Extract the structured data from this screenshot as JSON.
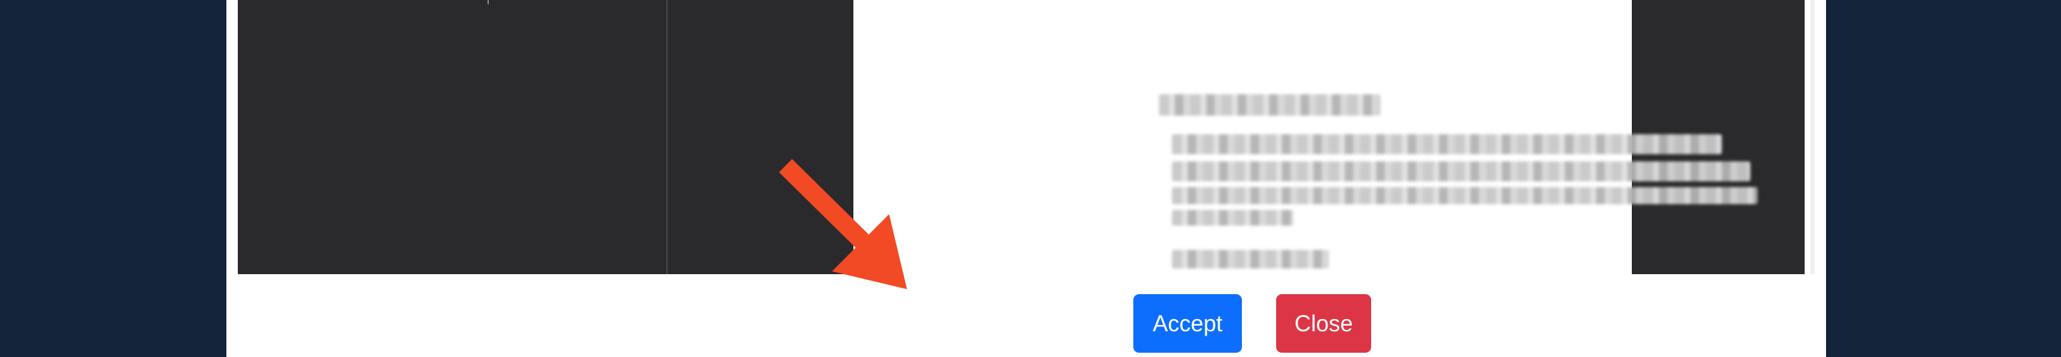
{
  "footer": {
    "accept_label": "Accept",
    "close_label": "Close"
  },
  "preview": {
    "cursor_glyph": "⸆"
  },
  "colors": {
    "page_background": "#12233a",
    "preview_background": "#2a2a2c",
    "accept_button": "#0d6efd",
    "close_button": "#dc3545",
    "annotation_arrow": "#f24a24"
  },
  "annotation": {
    "icon": "arrow-pointing-down-right"
  }
}
